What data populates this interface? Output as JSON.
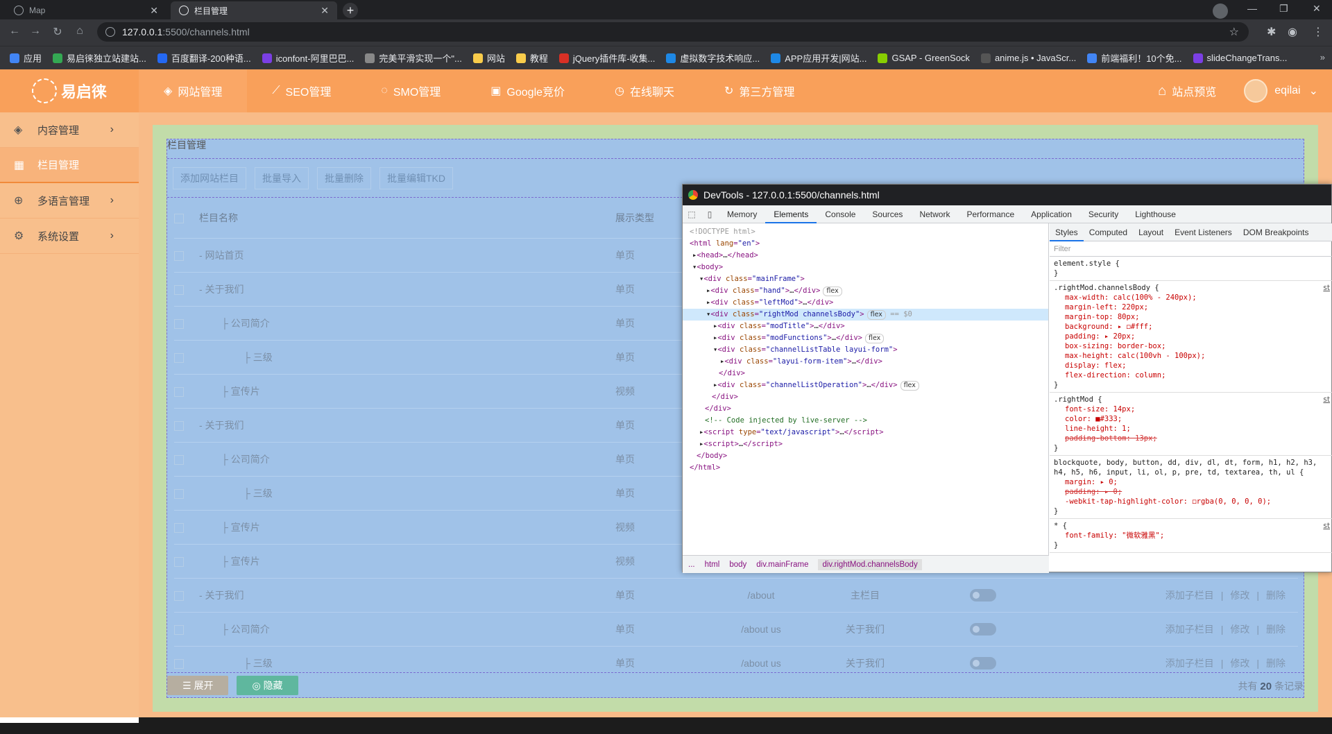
{
  "browser": {
    "tabs": [
      {
        "title": "Map",
        "active": false
      },
      {
        "title": "栏目管理",
        "active": true
      }
    ],
    "url_host": "127.0.0.1",
    "url_path": ":5500/channels.html",
    "bookmarks": [
      {
        "label": "应用",
        "color": "#4285f4"
      },
      {
        "label": "易启徕独立站建站...",
        "color": "#34a853"
      },
      {
        "label": "百度翻译-200种语...",
        "color": "#2468f2"
      },
      {
        "label": "iconfont-阿里巴巴...",
        "color": "#7b3fe4"
      },
      {
        "label": "完美平滑实现一个\"...",
        "color": "#888888"
      },
      {
        "label": "网站",
        "color": "#f9cc4b"
      },
      {
        "label": "教程",
        "color": "#f9cc4b"
      },
      {
        "label": "jQuery插件库-收集...",
        "color": "#d93025"
      },
      {
        "label": "虚拟数字技术响应...",
        "color": "#1e88e5"
      },
      {
        "label": "APP应用开发|网站...",
        "color": "#1e88e5"
      },
      {
        "label": "GSAP - GreenSock",
        "color": "#88ce02"
      },
      {
        "label": "anime.js • JavaScr...",
        "color": "#555555"
      },
      {
        "label": "前端福利！10个免...",
        "color": "#4285f4"
      },
      {
        "label": "slideChangeTrans...",
        "color": "#7b3fe4"
      }
    ]
  },
  "header": {
    "logo": "易启徕",
    "nav": [
      {
        "label": "网站管理",
        "icon": "layers-icon",
        "active": true
      },
      {
        "label": "SEO管理",
        "icon": "chart-icon",
        "active": false
      },
      {
        "label": "SMO管理",
        "icon": "chat-icon",
        "active": false
      },
      {
        "label": "Google竞价",
        "icon": "ad-icon",
        "active": false
      },
      {
        "label": "在线聊天",
        "icon": "clock-icon",
        "active": false
      },
      {
        "label": "第三方管理",
        "icon": "refresh-icon",
        "active": false
      }
    ],
    "preview": "站点预览",
    "user": "eqilai"
  },
  "sidebar": {
    "items": [
      {
        "label": "内容管理",
        "active": false,
        "chevron": true
      },
      {
        "label": "栏目管理",
        "active": true,
        "chevron": false
      },
      {
        "label": "多语言管理",
        "active": false,
        "chevron": true
      },
      {
        "label": "系统设置",
        "active": false,
        "chevron": true
      }
    ]
  },
  "main": {
    "title": "栏目管理",
    "functions": [
      "添加网站栏目",
      "批量导入",
      "批量删除",
      "批量编辑TKD"
    ],
    "columns": {
      "name": "栏目名称",
      "type": "展示类型"
    },
    "rows": [
      {
        "name": "- 网站首页",
        "indent": 0,
        "type": "单页",
        "path": "",
        "tpl": "",
        "ops": false
      },
      {
        "name": "-  关于我们",
        "indent": 0,
        "type": "单页",
        "path": "",
        "tpl": "",
        "ops": false
      },
      {
        "name": "├ 公司简介",
        "indent": 1,
        "type": "单页",
        "path": "",
        "tpl": "",
        "ops": false
      },
      {
        "name": "├ 三级",
        "indent": 2,
        "type": "单页",
        "path": "",
        "tpl": "",
        "ops": false
      },
      {
        "name": "├ 宣传片",
        "indent": 1,
        "type": "视频",
        "path": "",
        "tpl": "",
        "ops": false
      },
      {
        "name": "-  关于我们",
        "indent": 0,
        "type": "单页",
        "path": "",
        "tpl": "",
        "ops": false
      },
      {
        "name": "├ 公司简介",
        "indent": 1,
        "type": "单页",
        "path": "",
        "tpl": "",
        "ops": false
      },
      {
        "name": "├ 三级",
        "indent": 2,
        "type": "单页",
        "path": "",
        "tpl": "",
        "ops": false
      },
      {
        "name": "├ 宣传片",
        "indent": 1,
        "type": "视频",
        "path": "",
        "tpl": "",
        "ops": false
      },
      {
        "name": "├ 宣传片",
        "indent": 1,
        "type": "视频",
        "path": "",
        "tpl": "",
        "ops": false
      },
      {
        "name": "-  关于我们",
        "indent": 0,
        "type": "单页",
        "path": "/about",
        "tpl": "主栏目",
        "ops": true
      },
      {
        "name": "├ 公司简介",
        "indent": 1,
        "type": "单页",
        "path": "/about us",
        "tpl": "关于我们",
        "ops": true
      },
      {
        "name": "├ 三级",
        "indent": 2,
        "type": "单页",
        "path": "/about us",
        "tpl": "关于我们",
        "ops": true
      }
    ],
    "ops": {
      "add": "添加子栏目",
      "edit": "修改",
      "del": "删除",
      "sep": "|"
    },
    "bottom": {
      "expand": "展开",
      "hide": "隐藏",
      "total_prefix": "共有",
      "total": "20",
      "total_suffix": "条记录"
    }
  },
  "devtools": {
    "title": "DevTools - 127.0.0.1:5500/channels.html",
    "tabs": [
      "Memory",
      "Elements",
      "Console",
      "Sources",
      "Network",
      "Performance",
      "Application",
      "Security",
      "Lighthouse"
    ],
    "active_tab": "Elements",
    "style_tabs": [
      "Styles",
      "Computed",
      "Layout",
      "Event Listeners",
      "DOM Breakpoints"
    ],
    "filter": "Filter",
    "crumbs": [
      "...",
      "html",
      "body",
      "div.mainFrame",
      "div.rightMod.channelsBody"
    ],
    "element_style": "element.style {",
    "close_brace": "}",
    "rule1_sel": ".rightMod.channelsBody {",
    "rule1_props": [
      "max-width: calc(100% - 240px);",
      "margin-left: 220px;",
      "margin-top: 80px;",
      "background: ▸ ◻#fff;",
      "padding: ▸ 20px;",
      "box-sizing: border-box;",
      "max-height: calc(100vh - 100px);",
      "display: flex;",
      "flex-direction: column;"
    ],
    "rule2_sel": ".rightMod {",
    "rule2_props": [
      "font-size: 14px;",
      "color: ■#333;",
      "line-height: 1;"
    ],
    "rule2_strike": "padding-bottom: 13px;",
    "rule3_sel": "blockquote, body, button, dd, div, dl, dt, form, h1, h2, h3, h4, h5, h6, input, li, ol, p, pre, td, textarea, th, ul {",
    "rule3_props": [
      "margin: ▸ 0;"
    ],
    "rule3_strike": "padding: ▸ 0;",
    "rule3_extra": "-webkit-tap-highlight-color: ◻rgba(0, 0, 0, 0);",
    "rule4_sel": "* {",
    "rule4_props": [
      "font-family: \"微软雅黑\";"
    ],
    "src": "st"
  }
}
